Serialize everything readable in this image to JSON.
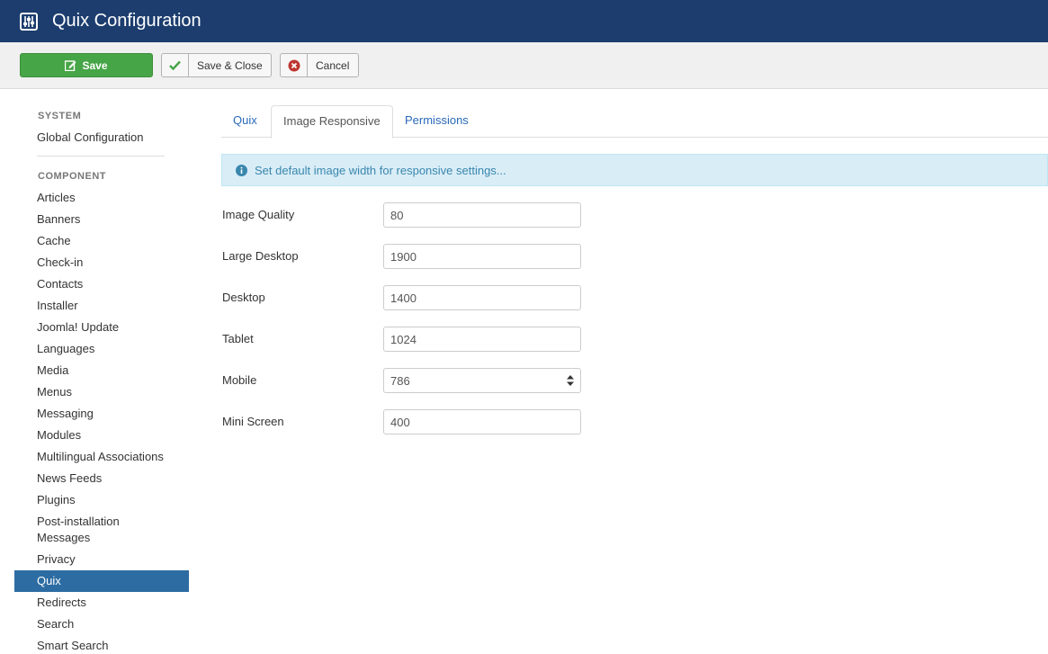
{
  "header": {
    "title": "Quix Configuration",
    "icon": "sliders-icon"
  },
  "toolbar": {
    "save_label": "Save",
    "save_close_label": "Save & Close",
    "cancel_label": "Cancel"
  },
  "sidebar": {
    "system_heading": "SYSTEM",
    "system_items": [
      "Global Configuration"
    ],
    "component_heading": "COMPONENT",
    "items": [
      "Articles",
      "Banners",
      "Cache",
      "Check-in",
      "Contacts",
      "Installer",
      "Joomla! Update",
      "Languages",
      "Media",
      "Menus",
      "Messaging",
      "Modules",
      "Multilingual Associations",
      "News Feeds",
      "Plugins",
      "Post-installation",
      "Messages",
      "Privacy",
      "Quix",
      "Redirects",
      "Search",
      "Smart Search"
    ],
    "active": "Quix"
  },
  "tabs": [
    "Quix",
    "Image Responsive",
    "Permissions"
  ],
  "active_tab": "Image Responsive",
  "alert": {
    "text": "Set default image width for responsive settings..."
  },
  "form": {
    "fields": [
      {
        "label": "Image Quality",
        "value": "80"
      },
      {
        "label": "Large Desktop",
        "value": "1900"
      },
      {
        "label": "Desktop",
        "value": "1400"
      },
      {
        "label": "Tablet",
        "value": "1024"
      },
      {
        "label": "Mobile",
        "value": "786"
      },
      {
        "label": "Mini Screen",
        "value": "400"
      }
    ]
  },
  "colors": {
    "header_bg": "#1c3d6e",
    "save_green": "#46a546",
    "active_blue": "#2d6ca2",
    "link_blue": "#2a69b8",
    "info_bg": "#d9edf7"
  }
}
